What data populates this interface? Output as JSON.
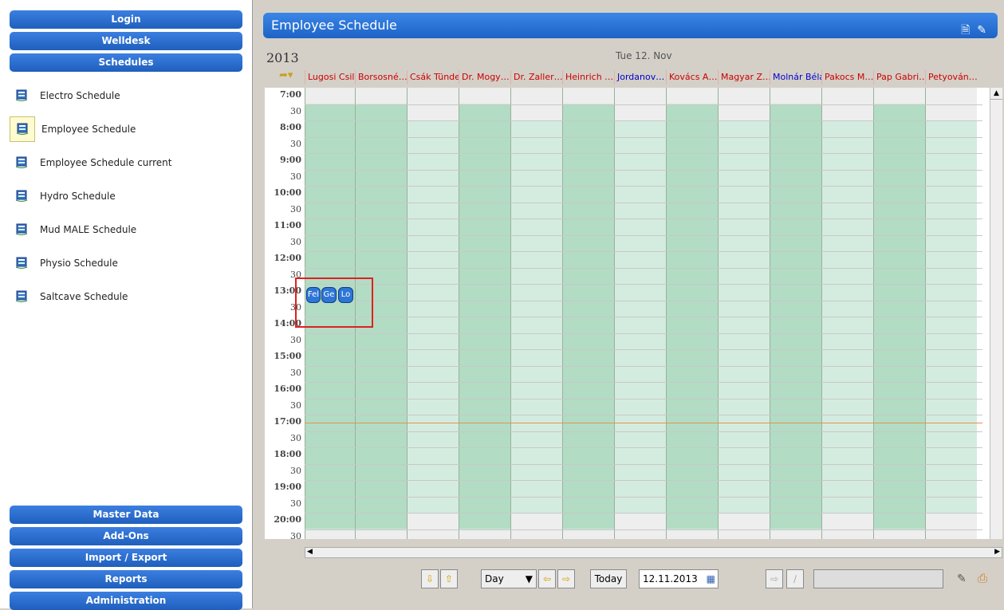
{
  "sidebar": {
    "top_buttons": [
      {
        "label": "Login",
        "name": "login-button"
      },
      {
        "label": "Welldesk",
        "name": "welldesk-button"
      },
      {
        "label": "Schedules",
        "name": "schedules-button"
      }
    ],
    "schedules": [
      {
        "label": "Electro Schedule",
        "selected": false
      },
      {
        "label": "Employee Schedule",
        "selected": true
      },
      {
        "label": "Employee Schedule current",
        "selected": false
      },
      {
        "label": "Hydro Schedule",
        "selected": false
      },
      {
        "label": "Mud MALE Schedule",
        "selected": false
      },
      {
        "label": "Physio Schedule",
        "selected": false
      },
      {
        "label": "Saltcave Schedule",
        "selected": false
      }
    ],
    "bottom_buttons": [
      {
        "label": "Master Data",
        "name": "master-data-button"
      },
      {
        "label": "Add-Ons",
        "name": "add-ons-button"
      },
      {
        "label": "Import / Export",
        "name": "import-export-button"
      },
      {
        "label": "Reports",
        "name": "reports-button"
      },
      {
        "label": "Administration",
        "name": "administration-button"
      }
    ]
  },
  "main": {
    "title": "Employee Schedule",
    "year": "2013",
    "day_label": "Tue 12. Nov",
    "employees": [
      {
        "name": "Lugosi Csilla",
        "color": "#cc0000",
        "working": true
      },
      {
        "name": "Borsosné…",
        "color": "#cc0000",
        "working": true
      },
      {
        "name": "Csák Tünde",
        "color": "#cc0000",
        "working": false
      },
      {
        "name": "Dr. Mogy…",
        "color": "#cc0000",
        "working": true
      },
      {
        "name": "Dr. Zaller…",
        "color": "#cc0000",
        "working": false
      },
      {
        "name": "Heinrich …",
        "color": "#cc0000",
        "working": true
      },
      {
        "name": "Jordanov…",
        "color": "#0000cc",
        "working": false
      },
      {
        "name": "Kovács A…",
        "color": "#cc0000",
        "working": true
      },
      {
        "name": "Magyar Z…",
        "color": "#cc0000",
        "working": false
      },
      {
        "name": "Molnár Béla",
        "color": "#0000cc",
        "working": true
      },
      {
        "name": "Pakocs M…",
        "color": "#cc0000",
        "working": false
      },
      {
        "name": "Pap Gabri…",
        "color": "#cc0000",
        "working": true
      },
      {
        "name": "Petyován…",
        "color": "#cc0000",
        "working": false
      }
    ],
    "time_labels": [
      "7:00",
      "30",
      "8:00",
      "30",
      "9:00",
      "30",
      "10:00",
      "30",
      "11:00",
      "30",
      "12:00",
      "30",
      "13:00",
      "30",
      "14:00",
      "30",
      "15:00",
      "30",
      "16:00",
      "30",
      "17:00",
      "30",
      "18:00",
      "30",
      "19:00",
      "30",
      "20:00",
      "30"
    ],
    "events": [
      {
        "label": "Fel"
      },
      {
        "label": "Ge"
      },
      {
        "label": "Lo"
      }
    ],
    "toolbar": {
      "view_select": "Day",
      "today_label": "Today",
      "date_value": "12.11.2013"
    }
  },
  "colors": {
    "working_dark": "#b2dcc4",
    "working_light": "#d4ece0",
    "offhours": "#eeeeee",
    "accent": "#1f5fbd"
  }
}
